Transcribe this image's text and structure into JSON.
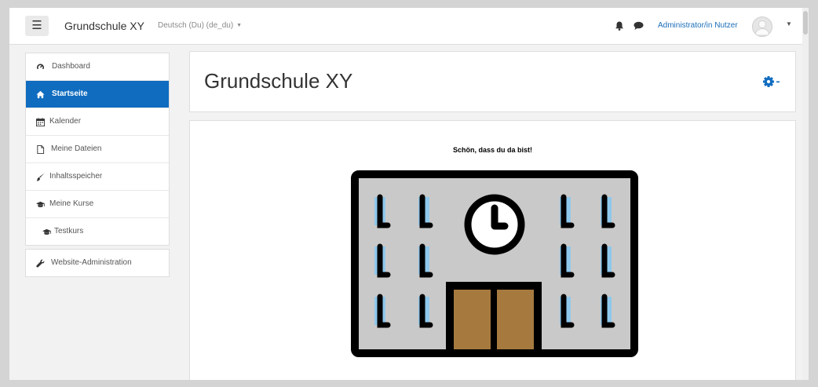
{
  "navbar": {
    "menu_icon": "hamburger-icon",
    "site_name": "Grundschule XY",
    "language": "Deutsch (Du) (de_du)",
    "notification_icon": "bell-icon",
    "messages_icon": "chat-icon",
    "user_name": "Administrator/in Nutzer",
    "avatar_icon": "avatar-icon"
  },
  "sidebar": {
    "items": [
      {
        "label": "Dashboard",
        "icon": "dashboard-icon",
        "active": false
      },
      {
        "label": "Startseite",
        "icon": "home-icon",
        "active": true
      },
      {
        "label": "Kalender",
        "icon": "calendar-icon",
        "active": false
      },
      {
        "label": "Meine Dateien",
        "icon": "file-icon",
        "active": false
      },
      {
        "label": "Inhaltsspeicher",
        "icon": "paintbrush-icon",
        "active": false
      },
      {
        "label": "Meine Kurse",
        "icon": "graduation-cap-icon",
        "active": false
      },
      {
        "label": "Testkurs",
        "icon": "graduation-cap-icon",
        "active": false
      }
    ],
    "admin": {
      "label": "Website-Administration",
      "icon": "wrench-icon"
    }
  },
  "main": {
    "title": "Grundschule XY",
    "settings_icon": "gear-icon",
    "welcome": "Schön, dass du da bist!",
    "image_icon": "school-building-icon"
  },
  "colors": {
    "accent": "#0f6cbf",
    "building_wall": "#c9c9c9",
    "window_glass": "#8fc8ec",
    "door": "#a67a3f"
  }
}
